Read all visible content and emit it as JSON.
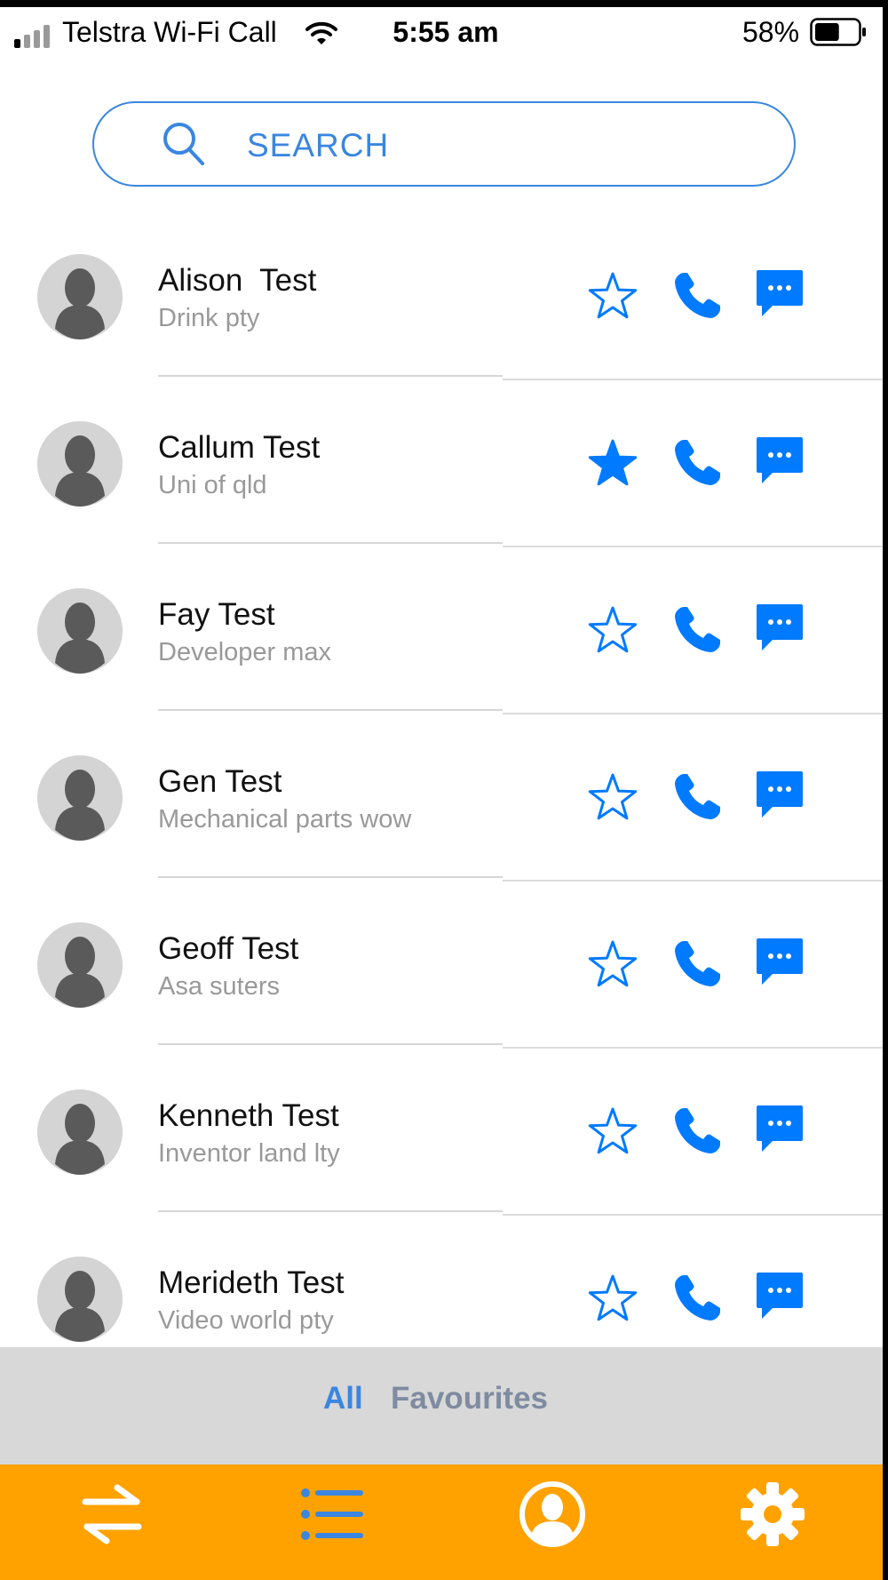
{
  "status_bar": {
    "carrier": "Telstra Wi-Fi Call",
    "time": "5:55 am",
    "battery_percent": "58%",
    "battery_level": 0.58
  },
  "search": {
    "placeholder": "SEARCH",
    "icon": "search-icon"
  },
  "contacts": [
    {
      "name": "Alison  Test",
      "company": "Drink pty",
      "favourite": false
    },
    {
      "name": "Callum Test",
      "company": "Uni of qld",
      "favourite": true
    },
    {
      "name": "Fay Test",
      "company": "Developer max",
      "favourite": false
    },
    {
      "name": "Gen Test",
      "company": "Mechanical parts wow",
      "favourite": false
    },
    {
      "name": "Geoff Test",
      "company": "Asa suters",
      "favourite": false
    },
    {
      "name": "Kenneth Test",
      "company": "Inventor land lty",
      "favourite": false
    },
    {
      "name": "Merideth Test",
      "company": "Video world pty",
      "favourite": false
    }
  ],
  "segments": {
    "all": "All",
    "favourites": "Favourites",
    "selected": "All"
  },
  "tab_bar": {
    "items": [
      "transfer-icon",
      "list-icon",
      "profile-icon",
      "settings-icon"
    ]
  },
  "colors": {
    "accent": "#007aff",
    "search_blue": "#3a86e0",
    "tab_bar": "#ffa200",
    "segment_bg": "#d8d8d8",
    "segment_inactive": "#7e8ba0"
  }
}
